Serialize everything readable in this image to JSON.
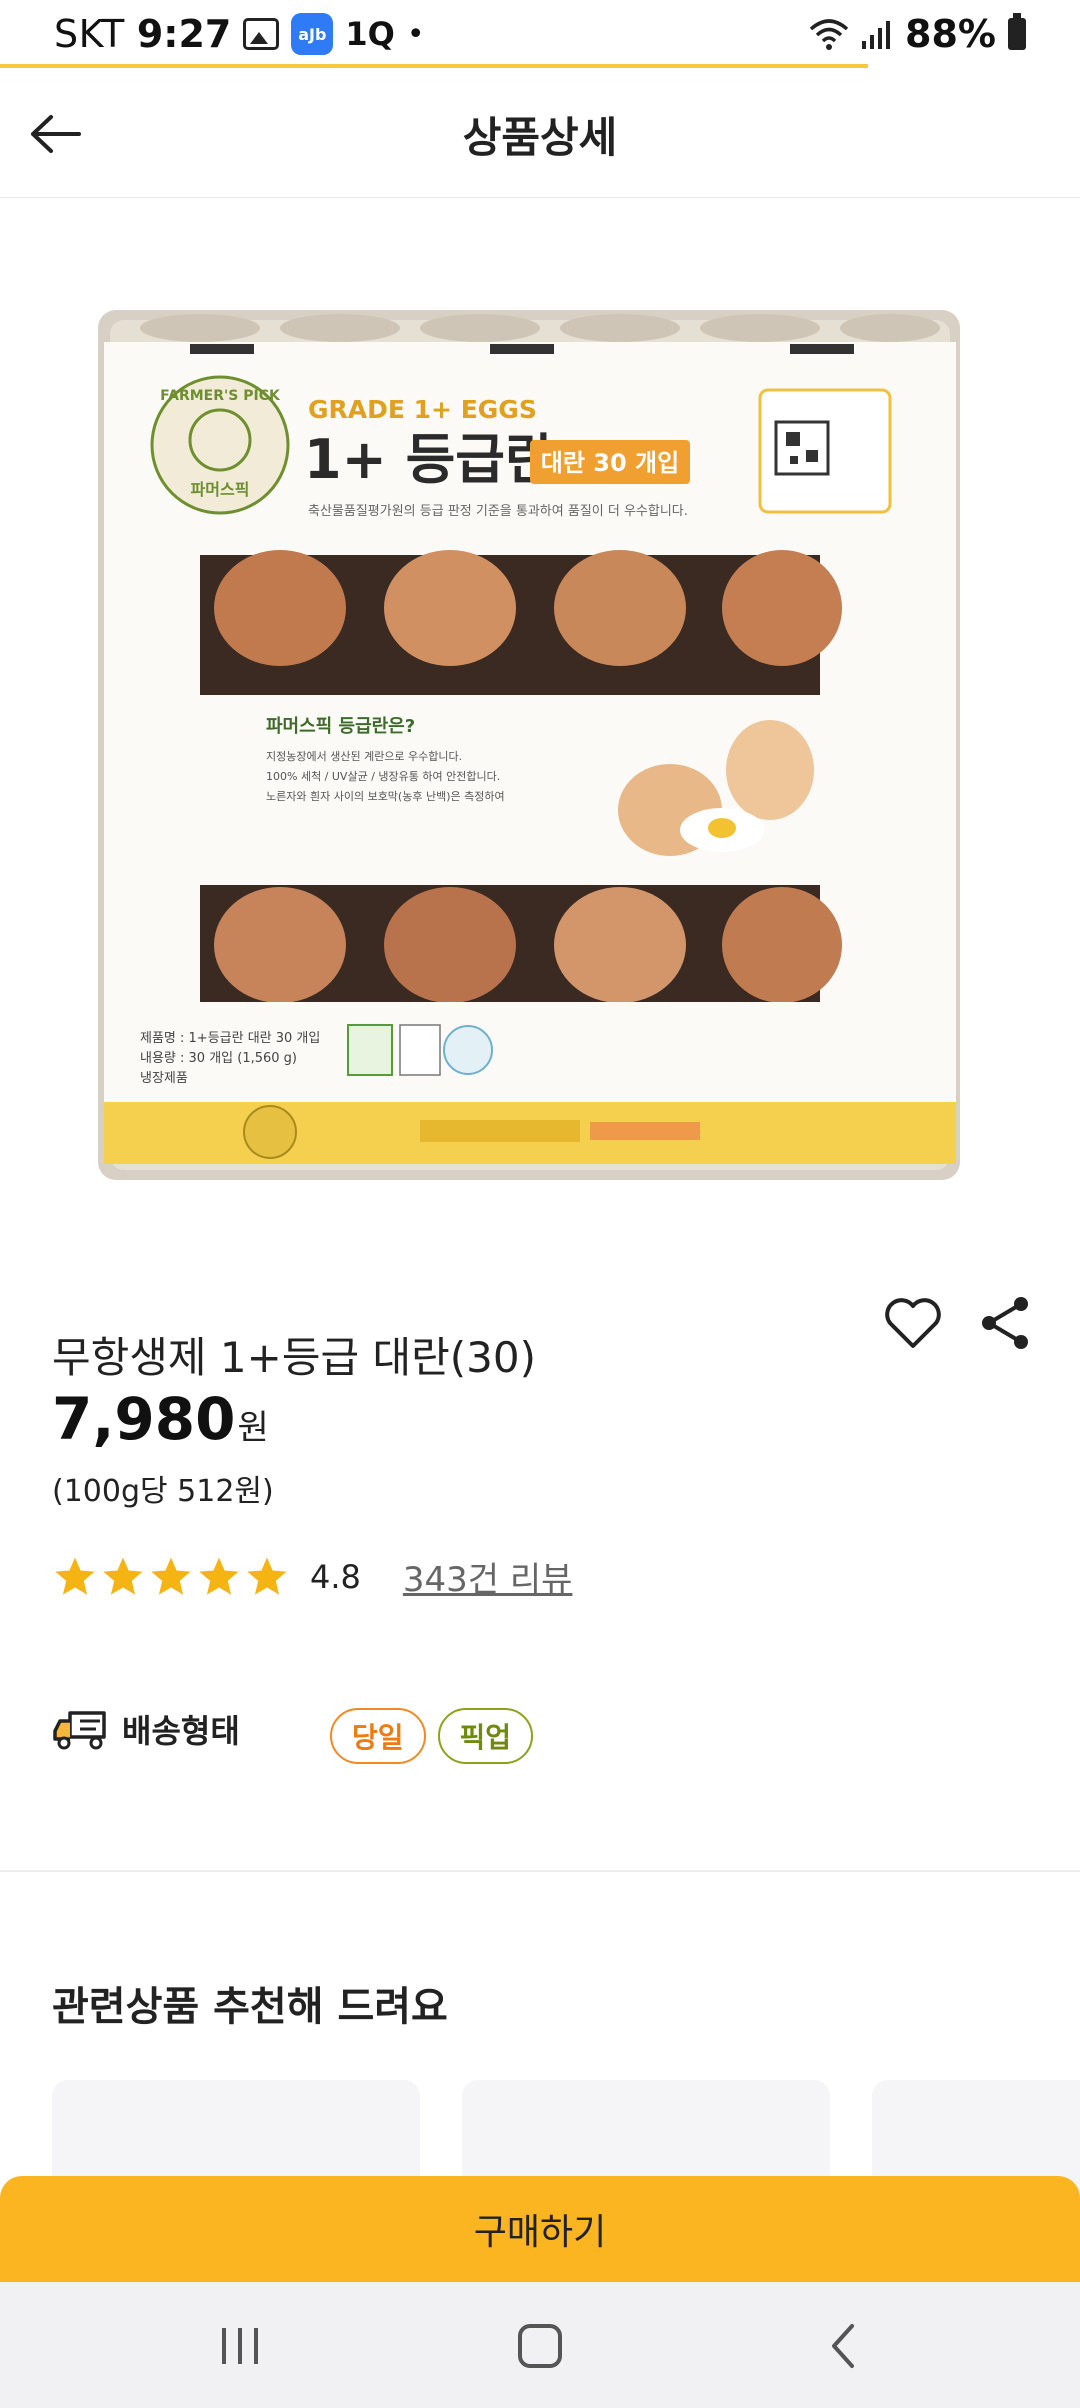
{
  "status_bar": {
    "carrier": "SKT",
    "time": "9:27",
    "notification_label": "1Q",
    "app_badge": "aJb",
    "battery": "88%"
  },
  "header": {
    "title": "상품상세"
  },
  "product": {
    "name": "무항생제 1+등급 대란(30)",
    "price": "7,980",
    "price_unit": "원",
    "unit_price": "(100g당 512원)",
    "rating": "4.8",
    "review_count": "343건 리뷰",
    "image": {
      "brand_circle_text": "FARMER'S PICK",
      "brand_korean": "파머스픽",
      "grade_english": "GRADE 1+ EGGS",
      "grade_korean": "1+ 등급란",
      "pack_badge": "대란 30 개입",
      "tagline": "축산물품질평가원의 등급 판정 기준을 통과하여 품질이 더 우수합니다.",
      "info_title": "파머스픽 등급란은?",
      "info_items": [
        "지정농장에서 생산된 계란으로 우수합니다.",
        "100% 세척 / UV살균 / 냉장유통 하여 안전합니다.",
        "노른자와 흰자 사이의 보호막(농후 난백)은 측정하여"
      ],
      "spec_name": "제품명 : 1+등급란 대란 30 개입",
      "spec_volume": "내용량 : 30 개입 (1,560 g)",
      "spec_storage": "냉장제품"
    }
  },
  "delivery": {
    "label": "배송형태",
    "badges": [
      "당일",
      "픽업"
    ]
  },
  "related": {
    "title": "관련상품 추천해 드려요"
  },
  "buy_button": {
    "label": "구매하기"
  },
  "colors": {
    "accent": "#fbb520",
    "star": "#f5b414",
    "sameday": "#ee7a12",
    "pickup": "#6f8a0e"
  }
}
